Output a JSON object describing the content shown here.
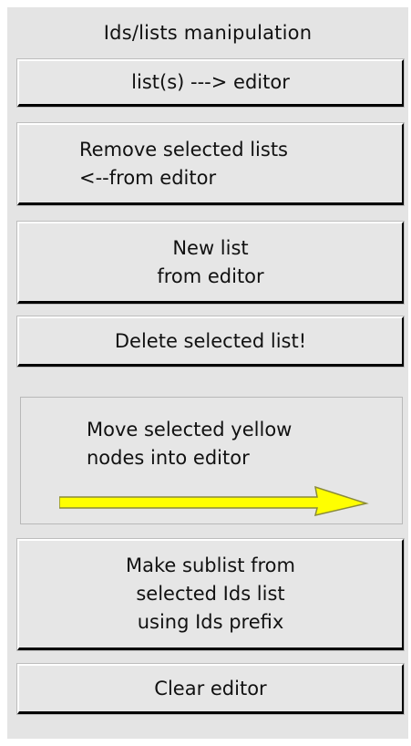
{
  "panel": {
    "title": "Ids/lists manipulation"
  },
  "buttons": {
    "list_to_editor": {
      "lines": [
        "list(s) ---> editor"
      ]
    },
    "remove_selected": {
      "lines": [
        "Remove selected lists",
        "<--from editor"
      ]
    },
    "new_list": {
      "lines": [
        "New list",
        "from editor"
      ]
    },
    "delete_selected": {
      "lines": [
        "Delete selected list!"
      ]
    },
    "move_nodes": {
      "lines": [
        "Move selected yellow",
        "nodes into editor"
      ]
    },
    "make_sublist": {
      "lines": [
        "Make sublist from",
        "selected Ids list",
        "using Ids prefix"
      ]
    },
    "clear_editor": {
      "lines": [
        "Clear editor"
      ]
    }
  },
  "icons": {
    "arrow": {
      "name": "arrow-right-icon",
      "fill": "#ffff00",
      "stroke": "#8a8a3a"
    }
  }
}
